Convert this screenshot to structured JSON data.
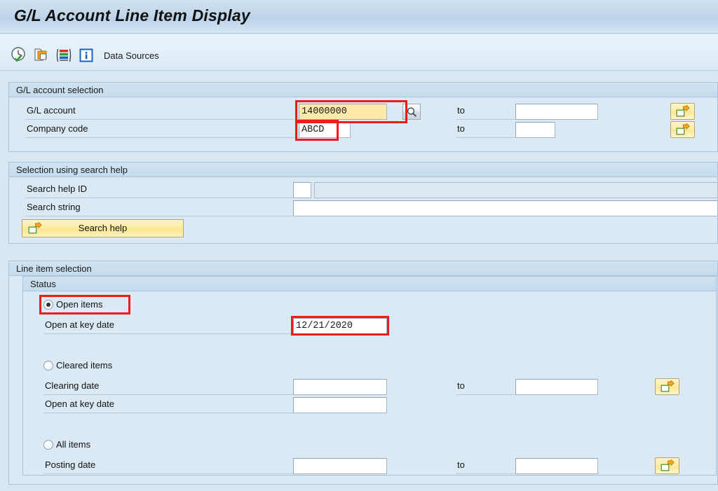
{
  "window": {
    "title": "G/L Account Line Item Display"
  },
  "toolbar": {
    "icons": [
      {
        "name": "execute-clock-icon",
        "title": "Execute"
      },
      {
        "name": "multiple-selection-icon",
        "title": "Multiple Selection"
      },
      {
        "name": "list-variant-icon",
        "title": "Layout"
      },
      {
        "name": "info-icon",
        "title": "Information"
      }
    ],
    "data_sources_label": "Data Sources"
  },
  "sections": {
    "gl_account_selection": {
      "header": "G/L account selection",
      "fields": [
        {
          "label": "G/L account",
          "value": "14000000",
          "focused": true,
          "has_search_help": true,
          "to_label": "to",
          "to_value": "",
          "multi_select": true,
          "annotated": true
        },
        {
          "label": "Company code",
          "value": "ABCD",
          "focused": false,
          "has_search_help": false,
          "to_label": "to",
          "to_value": "",
          "multi_select": true,
          "annotated": true
        }
      ]
    },
    "selection_using_search_help": {
      "header": "Selection using search help",
      "fields": [
        {
          "label": "Search help ID",
          "value": "",
          "value2": ""
        },
        {
          "label": "Search string",
          "value": ""
        }
      ],
      "button": {
        "label": "Search help",
        "icon": "multiple-selection-icon"
      }
    },
    "line_item_selection": {
      "header": "Line item selection",
      "status_group": {
        "header": "Status",
        "options": [
          {
            "id": "open-items",
            "label": "Open items",
            "selected": true,
            "annotated": true,
            "fields": [
              {
                "label": "Open at key date",
                "value": "12/21/2020",
                "annotated": true,
                "to_label": "",
                "to_value": "",
                "multi_select": false
              }
            ]
          },
          {
            "id": "cleared-items",
            "label": "Cleared items",
            "selected": false,
            "annotated": false,
            "fields": [
              {
                "label": "Clearing date",
                "value": "",
                "to_label": "to",
                "to_value": "",
                "multi_select": true
              },
              {
                "label": "Open at key date",
                "value": "",
                "to_label": "",
                "to_value": "",
                "multi_select": false
              }
            ]
          },
          {
            "id": "all-items",
            "label": "All items",
            "selected": false,
            "annotated": false,
            "fields": [
              {
                "label": "Posting date",
                "value": "",
                "to_label": "to",
                "to_value": "",
                "multi_select": true
              }
            ]
          }
        ]
      }
    }
  },
  "colors": {
    "background": "#dbe9f4",
    "panel_header": "#c9dfef",
    "focus_field": "#fde9a9",
    "annotation": "#ee1c19",
    "button_yellow": "#fbeda5"
  }
}
